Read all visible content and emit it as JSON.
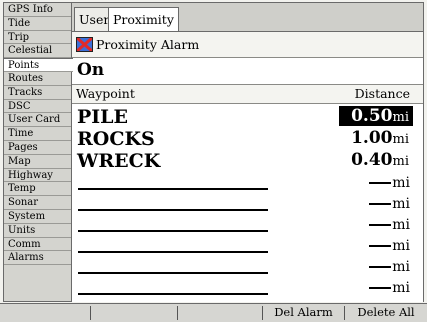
{
  "menu": {
    "items": [
      "GPS Info",
      "Tide",
      "Trip",
      "Celestial",
      "Points",
      "Routes",
      "Tracks",
      "DSC",
      "User Card",
      "Time",
      "Pages",
      "Map",
      "Highway",
      "Temp",
      "Sonar",
      "System",
      "Units",
      "Comm",
      "Alarms"
    ],
    "selected_index": 4
  },
  "tabs": [
    "User",
    "Proximity"
  ],
  "active_tab": "Proximity",
  "alarm": {
    "label": "Proximity Alarm",
    "status": "On"
  },
  "table": {
    "headers": {
      "waypoint": "Waypoint",
      "distance": "Distance"
    },
    "rows": [
      {
        "name": "PILE",
        "distance": "0.50",
        "unit": "mi",
        "selected": true
      },
      {
        "name": "ROCKS",
        "distance": "1.00",
        "unit": "mi",
        "selected": false
      },
      {
        "name": "WRECK",
        "distance": "0.40",
        "unit": "mi",
        "selected": false
      }
    ],
    "blank_unit": "mi",
    "blank_rows": 6
  },
  "softkeys": {
    "del_alarm": "Del Alarm",
    "delete_all": "Delete All"
  },
  "colors": {
    "highlight_bg": "#000000",
    "highlight_fg": "#ffffff"
  }
}
